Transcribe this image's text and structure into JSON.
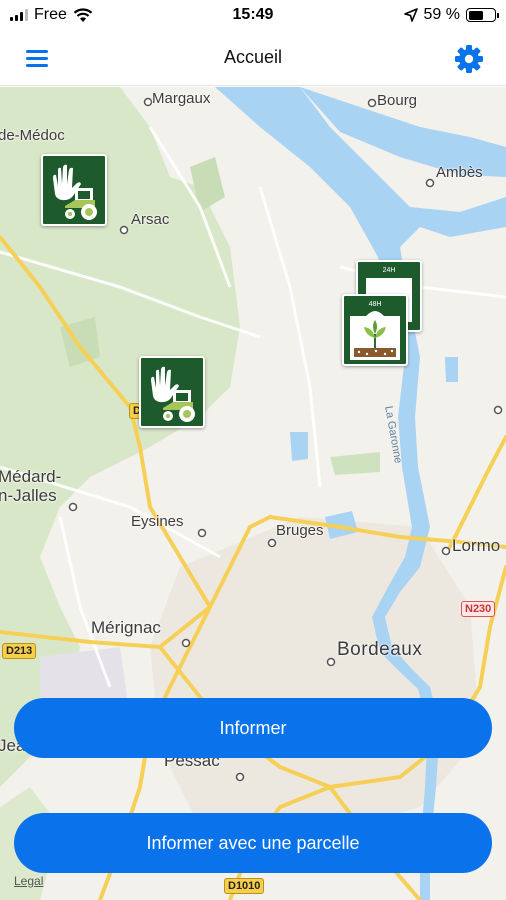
{
  "status_bar": {
    "carrier": "Free",
    "time": "15:49",
    "battery": "59 %",
    "battery_level": 0.59
  },
  "nav": {
    "title": "Accueil",
    "menu_icon": "hamburger-menu-icon",
    "settings_icon": "gear-icon"
  },
  "map": {
    "places": {
      "margaux": "Margaux",
      "bourg": "Bourg",
      "de_medoc": "de-Médoc",
      "ambes": "Ambès",
      "arsac": "Arsac",
      "medard_1": "Médard-",
      "medard_2": "n-Jalles",
      "eysines": "Eysines",
      "bruges": "Bruges",
      "lormont": "Lormo",
      "merignac": "Mérignac",
      "bordeaux": "Bordeaux",
      "pessac": "Pessac",
      "eac": "Jea"
    },
    "roads": {
      "d213": "D213",
      "n230": "N230",
      "d1010": "D1010",
      "d_partial": "D"
    },
    "river": "La Garonne",
    "legal": "Legal",
    "markers": {
      "stacked_front_label": "48H",
      "stacked_back_label": "24H"
    }
  },
  "buttons": {
    "informer": "Informer",
    "informer_parcelle": "Informer avec une parcelle"
  },
  "colors": {
    "accent": "#0a72ea",
    "marker_green": "#1d5a2c",
    "water": "#a9d3f3"
  }
}
